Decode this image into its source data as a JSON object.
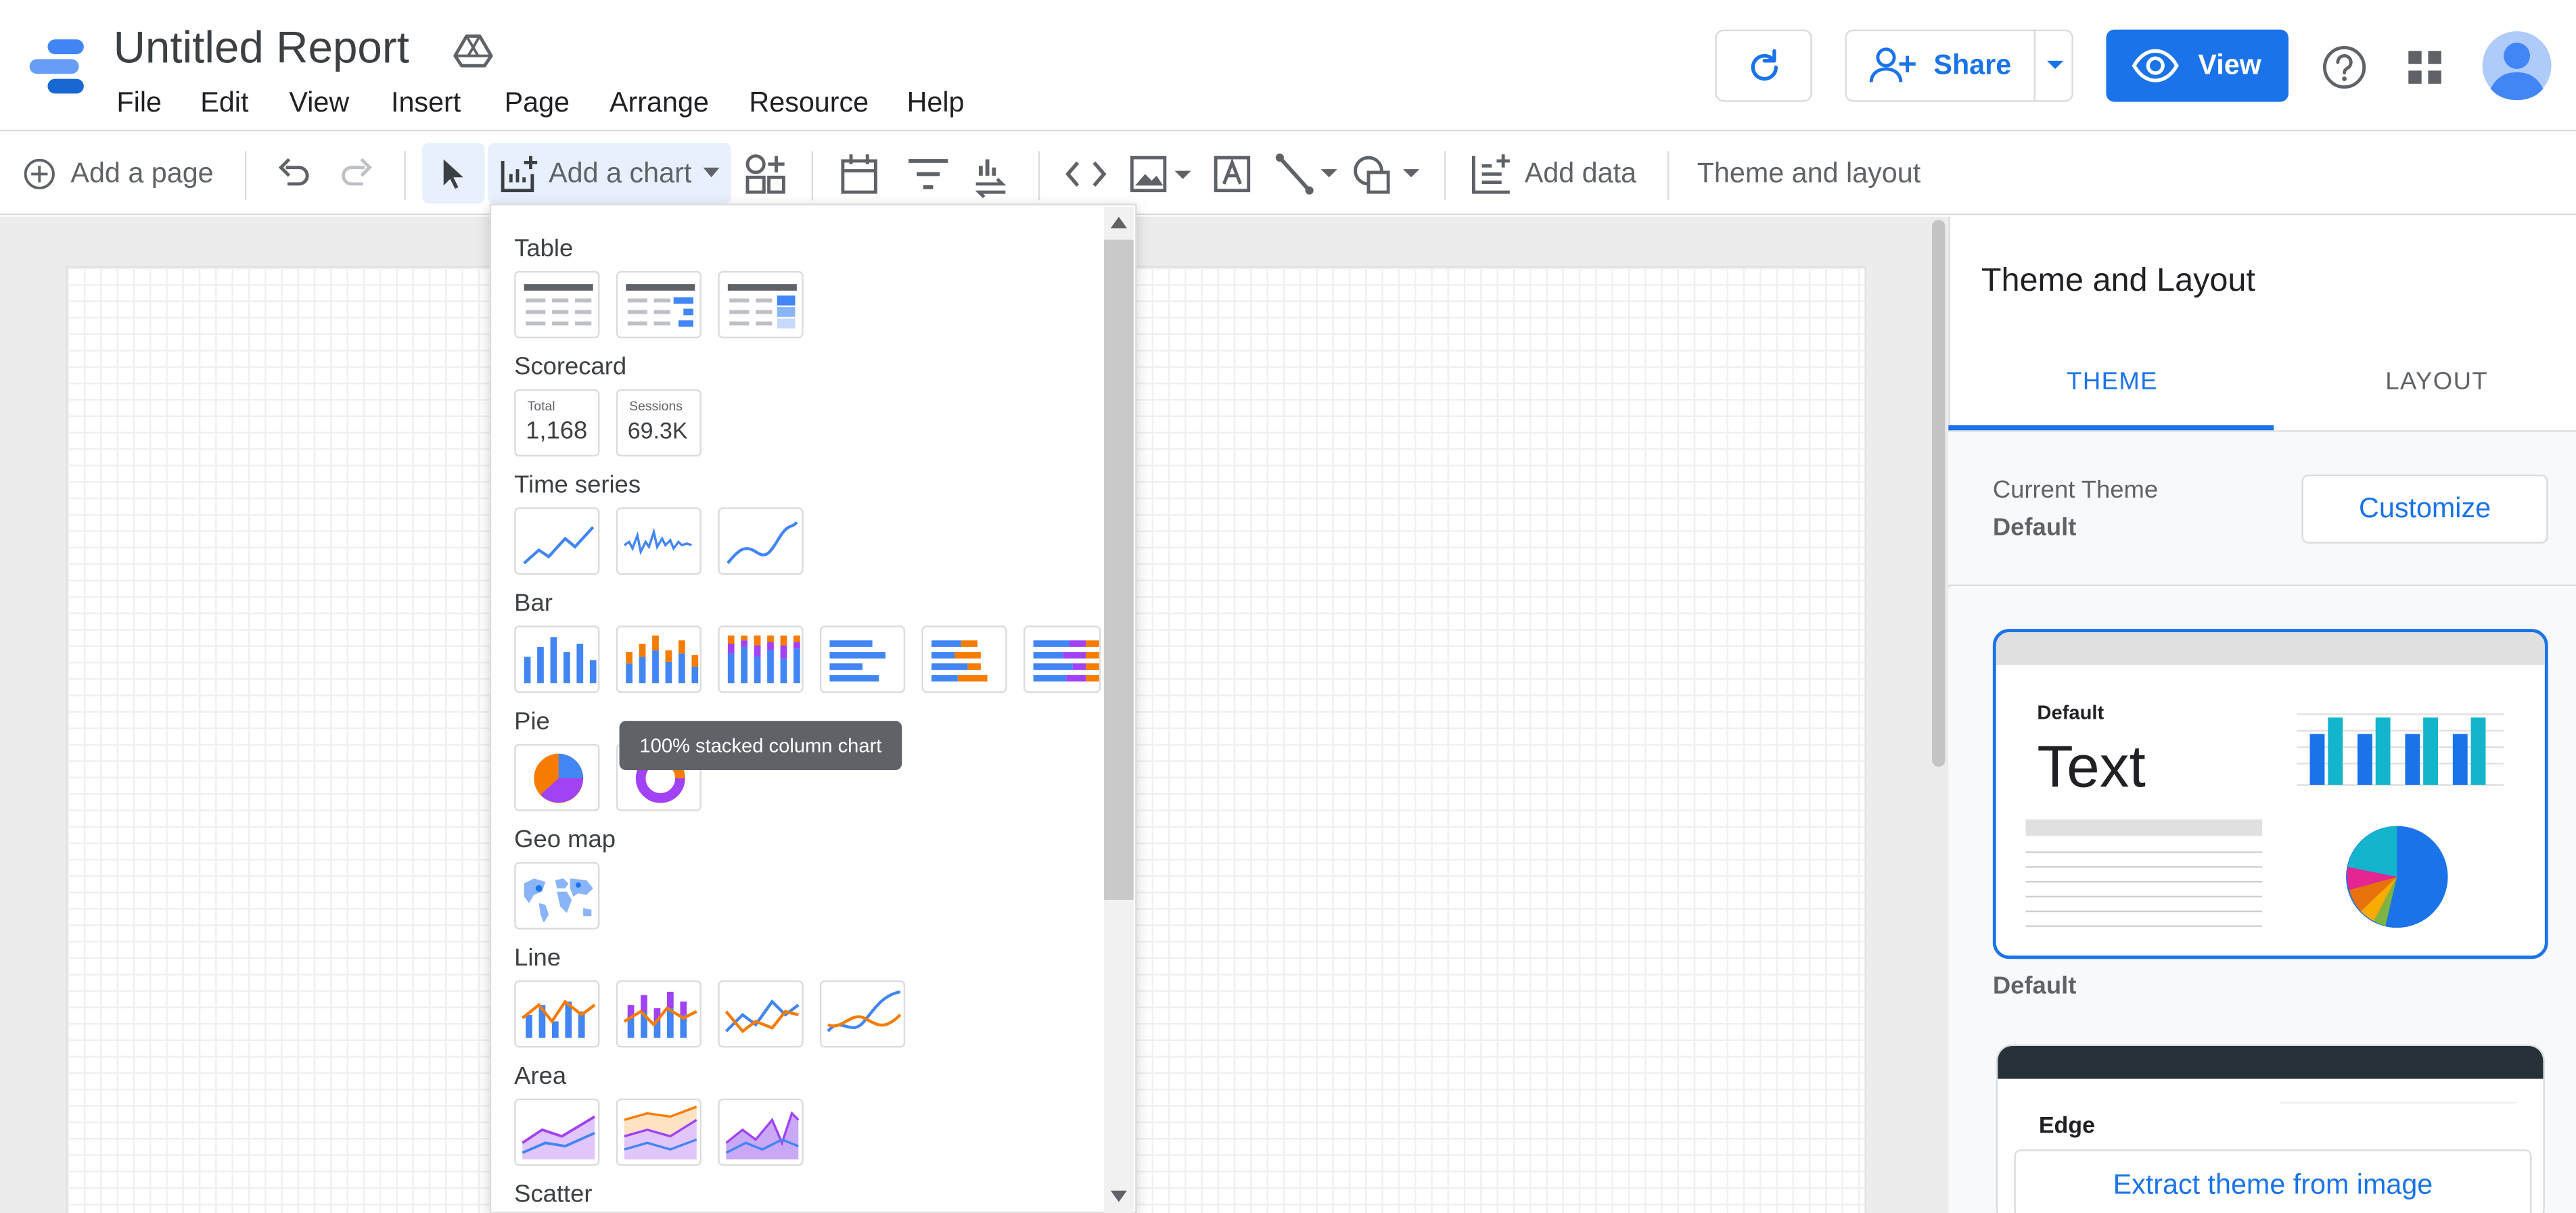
{
  "header": {
    "title": "Untitled Report",
    "menu": [
      "File",
      "Edit",
      "View",
      "Insert",
      "Page",
      "Arrange",
      "Resource",
      "Help"
    ],
    "share_label": "Share",
    "view_label": "View"
  },
  "toolbar": {
    "add_page_label": "Add a page",
    "add_chart_label": "Add a chart",
    "add_data_label": "Add data",
    "theme_layout_label": "Theme and layout"
  },
  "chart_menu": {
    "sections": {
      "table": "Table",
      "scorecard": "Scorecard",
      "time_series": "Time series",
      "bar": "Bar",
      "pie": "Pie",
      "geo_map": "Geo map",
      "line": "Line",
      "area": "Area",
      "scatter": "Scatter"
    },
    "scorecards": [
      {
        "label": "Total",
        "value": "1,168"
      },
      {
        "label": "Sessions",
        "value": "69.3K"
      }
    ],
    "tooltip": "100% stacked column chart"
  },
  "panel": {
    "title": "Theme and Layout",
    "tabs": [
      "THEME",
      "LAYOUT"
    ],
    "active_tab": "THEME",
    "current_theme_label": "Current Theme",
    "current_theme_value": "Default",
    "customize_label": "Customize",
    "theme_cards": [
      {
        "heading": "Default",
        "sample_text": "Text",
        "caption": "Default"
      },
      {
        "heading": "Edge"
      }
    ],
    "extract_label": "Extract theme from image"
  },
  "colors": {
    "accent": "#1a73e8",
    "chart_blue": "#4285f4",
    "chart_orange": "#f57c00",
    "chart_purple": "#a142f4",
    "theme_cyan": "#12b5cb"
  }
}
